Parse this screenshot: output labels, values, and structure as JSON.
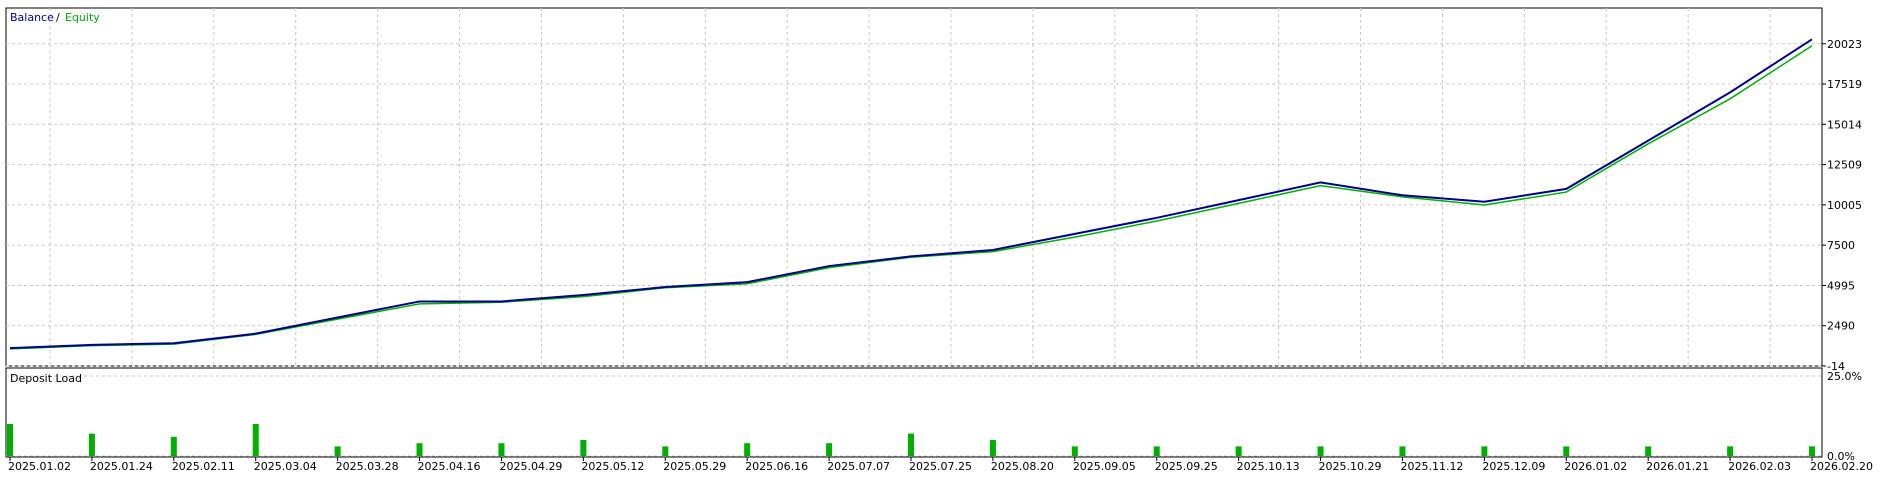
{
  "chart_data": [
    {
      "type": "line",
      "title": "",
      "legend": [
        "Balance",
        "Equity"
      ],
      "legend_separator": "/",
      "legend_placement": "top-left",
      "grid": true,
      "colors": {
        "balance": "#00008b",
        "equity": "#00b000",
        "grid": "#c8c8c8",
        "axis": "#000000"
      },
      "ylim": [
        -14,
        21500
      ],
      "y_ticks": [
        20023,
        17519,
        15014,
        12509,
        10005,
        7500,
        4995,
        2490,
        -14
      ],
      "x_tick_labels": [
        "2025.01.02",
        "2025.01.24",
        "2025.02.11",
        "2025.03.04",
        "2025.03.28",
        "2025.04.16",
        "2025.04.29",
        "2025.05.12",
        "2025.05.29",
        "2025.06.16",
        "2025.07.07",
        "2025.07.25",
        "2025.08.20",
        "2025.09.05",
        "2025.09.25",
        "2025.10.13",
        "2025.10.29",
        "2025.11.12",
        "2025.12.09",
        "2026.01.02",
        "2026.01.21",
        "2026.02.03",
        "2026.02.20"
      ],
      "series": [
        {
          "name": "Balance",
          "x": [
            "2025.01.02",
            "2025.01.24",
            "2025.02.11",
            "2025.03.04",
            "2025.03.28",
            "2025.04.16",
            "2025.04.29",
            "2025.05.12",
            "2025.05.29",
            "2025.06.16",
            "2025.07.07",
            "2025.07.25",
            "2025.08.20",
            "2025.09.05",
            "2025.09.25",
            "2025.10.13",
            "2025.10.29",
            "2025.11.12",
            "2025.12.09",
            "2026.01.02",
            "2026.01.21",
            "2026.02.03",
            "2026.02.20"
          ],
          "values": [
            1100,
            1300,
            1400,
            2000,
            3000,
            4000,
            4000,
            4400,
            4900,
            5200,
            6200,
            6800,
            7200,
            8200,
            9200,
            10300,
            11400,
            10600,
            10200,
            11000,
            14000,
            17000,
            20300
          ]
        },
        {
          "name": "Equity",
          "x": [
            "2025.01.02",
            "2025.01.24",
            "2025.02.11",
            "2025.03.04",
            "2025.03.28",
            "2025.04.16",
            "2025.04.29",
            "2025.05.12",
            "2025.05.29",
            "2025.06.16",
            "2025.07.07",
            "2025.07.25",
            "2025.08.20",
            "2025.09.05",
            "2025.09.25",
            "2025.10.13",
            "2025.10.29",
            "2025.11.12",
            "2025.12.09",
            "2026.01.02",
            "2026.01.21",
            "2026.02.03",
            "2026.02.20"
          ],
          "values": [
            1050,
            1250,
            1350,
            1950,
            2900,
            3850,
            3950,
            4300,
            4850,
            5100,
            6100,
            6750,
            7100,
            8000,
            9000,
            10100,
            11200,
            10500,
            10000,
            10800,
            13800,
            16600,
            19900
          ]
        }
      ]
    },
    {
      "type": "bar",
      "title": "Deposit Load",
      "ylim": [
        0,
        25
      ],
      "y_ticks": [
        "25.0%",
        "0.0%"
      ],
      "colors": {
        "bar": "#00b000"
      },
      "categories": [
        "2025.01.02",
        "2025.01.24",
        "2025.02.11",
        "2025.03.04",
        "2025.03.28",
        "2025.04.16",
        "2025.04.29",
        "2025.05.12",
        "2025.05.29",
        "2025.06.16",
        "2025.07.07",
        "2025.07.25",
        "2025.08.20",
        "2025.09.05",
        "2025.09.25",
        "2025.10.13",
        "2025.10.29",
        "2025.11.12",
        "2025.12.09",
        "2026.01.02",
        "2026.01.21",
        "2026.02.03",
        "2026.02.20"
      ],
      "values": [
        10,
        7,
        6,
        10,
        3,
        4,
        4,
        5,
        3,
        4,
        4,
        7,
        5,
        3,
        3,
        3,
        3,
        3,
        3,
        3,
        3,
        3,
        3
      ]
    }
  ]
}
